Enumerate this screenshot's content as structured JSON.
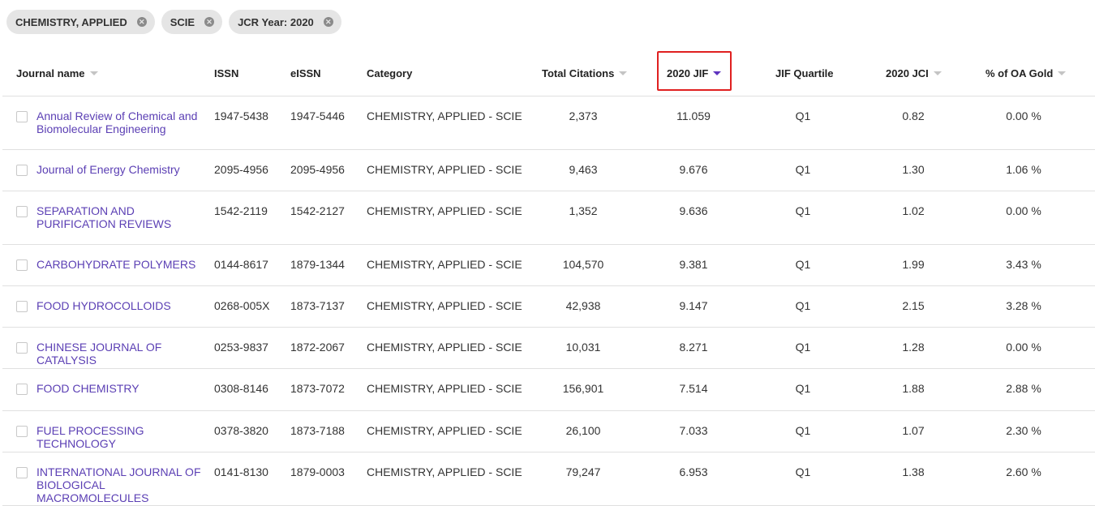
{
  "filters": [
    {
      "label": "CHEMISTRY, APPLIED"
    },
    {
      "label": "SCIE"
    },
    {
      "label": "JCR Year: 2020"
    }
  ],
  "columns": {
    "journal_name": "Journal name",
    "issn": "ISSN",
    "eissn": "eISSN",
    "category": "Category",
    "total_citations": "Total Citations",
    "jif": "2020 JIF",
    "jif_quartile": "JIF Quartile",
    "jci": "2020 JCI",
    "oa_gold": "% of OA Gold"
  },
  "rows": [
    {
      "name": "Annual Review of Chemical and Biomolecular Engineering",
      "issn": "1947-5438",
      "eissn": "1947-5446",
      "category": "CHEMISTRY, APPLIED - SCIE",
      "citations": "2,373",
      "jif": "11.059",
      "quartile": "Q1",
      "jci": "0.82",
      "oa": "0.00 %"
    },
    {
      "name": "Journal of Energy Chemistry",
      "issn": "2095-4956",
      "eissn": "2095-4956",
      "category": "CHEMISTRY, APPLIED - SCIE",
      "citations": "9,463",
      "jif": "9.676",
      "quartile": "Q1",
      "jci": "1.30",
      "oa": "1.06 %"
    },
    {
      "name": "SEPARATION AND PURIFICATION REVIEWS",
      "issn": "1542-2119",
      "eissn": "1542-2127",
      "category": "CHEMISTRY, APPLIED - SCIE",
      "citations": "1,352",
      "jif": "9.636",
      "quartile": "Q1",
      "jci": "1.02",
      "oa": "0.00 %"
    },
    {
      "name": "CARBOHYDRATE POLYMERS",
      "issn": "0144-8617",
      "eissn": "1879-1344",
      "category": "CHEMISTRY, APPLIED - SCIE",
      "citations": "104,570",
      "jif": "9.381",
      "quartile": "Q1",
      "jci": "1.99",
      "oa": "3.43 %"
    },
    {
      "name": "FOOD HYDROCOLLOIDS",
      "issn": "0268-005X",
      "eissn": "1873-7137",
      "category": "CHEMISTRY, APPLIED - SCIE",
      "citations": "42,938",
      "jif": "9.147",
      "quartile": "Q1",
      "jci": "2.15",
      "oa": "3.28 %"
    },
    {
      "name": "CHINESE JOURNAL OF CATALYSIS",
      "issn": "0253-9837",
      "eissn": "1872-2067",
      "category": "CHEMISTRY, APPLIED - SCIE",
      "citations": "10,031",
      "jif": "8.271",
      "quartile": "Q1",
      "jci": "1.28",
      "oa": "0.00 %"
    },
    {
      "name": "FOOD CHEMISTRY",
      "issn": "0308-8146",
      "eissn": "1873-7072",
      "category": "CHEMISTRY, APPLIED - SCIE",
      "citations": "156,901",
      "jif": "7.514",
      "quartile": "Q1",
      "jci": "1.88",
      "oa": "2.88 %"
    },
    {
      "name": "FUEL PROCESSING TECHNOLOGY",
      "issn": "0378-3820",
      "eissn": "1873-7188",
      "category": "CHEMISTRY, APPLIED - SCIE",
      "citations": "26,100",
      "jif": "7.033",
      "quartile": "Q1",
      "jci": "1.07",
      "oa": "2.30 %"
    },
    {
      "name": "INTERNATIONAL JOURNAL OF BIOLOGICAL MACROMOLECULES",
      "issn": "0141-8130",
      "eissn": "1879-0003",
      "category": "CHEMISTRY, APPLIED - SCIE",
      "citations": "79,247",
      "jif": "6.953",
      "quartile": "Q1",
      "jci": "1.38",
      "oa": "2.60 %"
    }
  ],
  "colors": {
    "link": "#5b3fb4",
    "sort_active": "#5e33bf",
    "highlight_box": "#e02020",
    "chip_bg": "#e5e5e5"
  }
}
